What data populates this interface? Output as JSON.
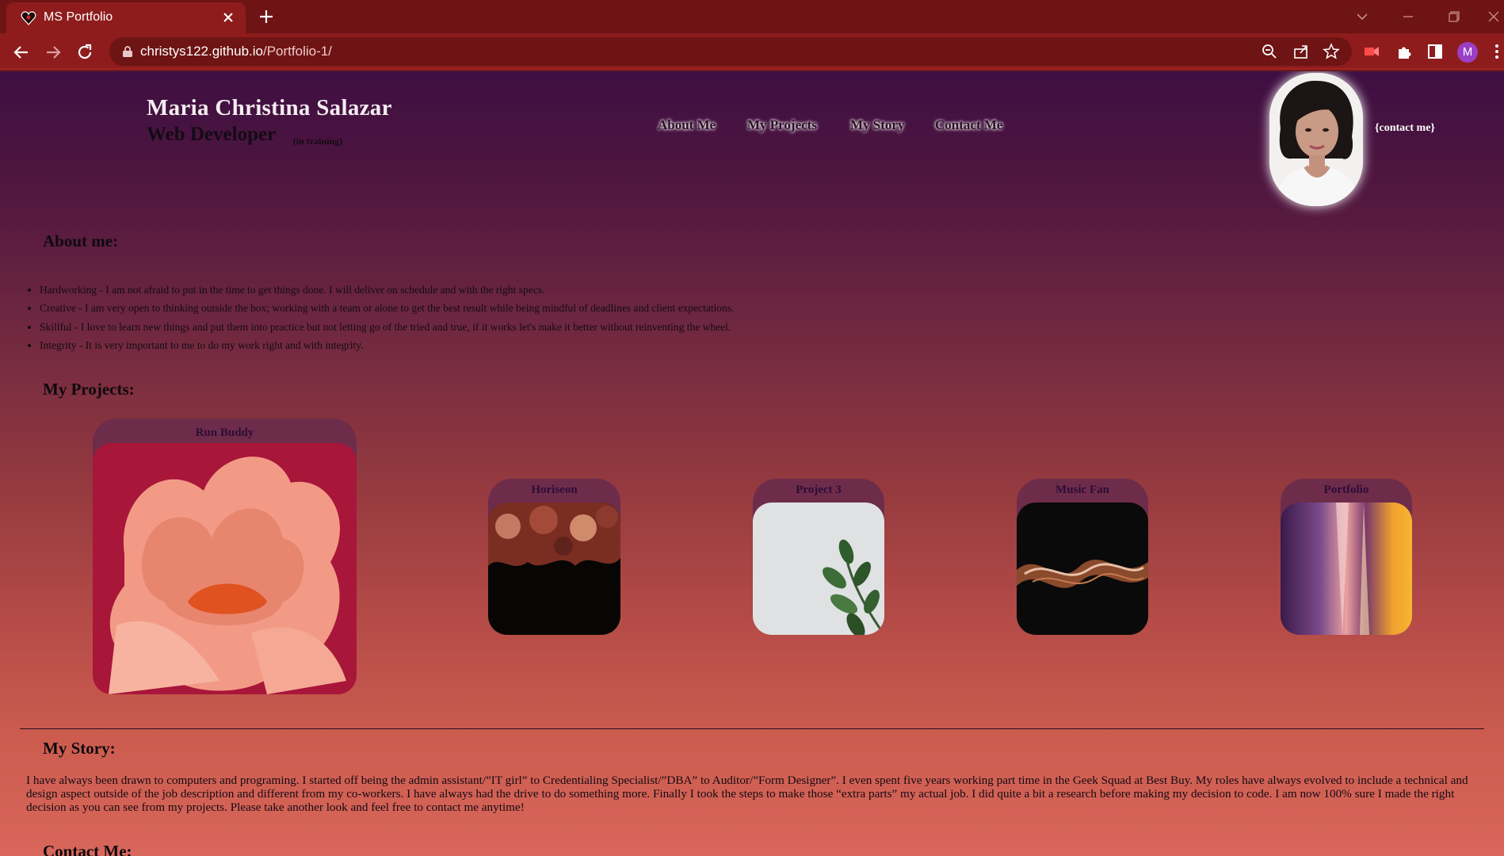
{
  "browser": {
    "tab_title": "MS Portfolio",
    "url_host": "christys122.github.io",
    "url_path": "/Portfolio-1/",
    "profile_initial": "M",
    "theme_color": "#8e1c1c"
  },
  "header": {
    "name": "Maria Christina Salazar",
    "role": "Web Developer",
    "role_note": "{in training}",
    "contact_link": "{contact me}"
  },
  "nav": {
    "about": "About Me",
    "projects": "My Projects",
    "story": "My Story",
    "contact": "Contact Me"
  },
  "about": {
    "heading": "About me:",
    "items": [
      "Hardworking - I am not afraid to put in the time to get things done. I will deliver on schedule and with the right specs.",
      "Creative - I am very open to thinking outside the box; working with a team or alone to get the best result while being mindful of deadlines and client expectations.",
      "Skillful - I love to learn new things and put them into practice but not letting go of the tried and true, if it works let's make it better without reinventing the wheel.",
      "Integrity - It is very important to me to do my work right and with integrity."
    ]
  },
  "projects": {
    "heading": "My Projects:",
    "items": [
      {
        "label": "Run Buddy"
      },
      {
        "label": "Horiseon"
      },
      {
        "label": "Project 3"
      },
      {
        "label": "Music Fan"
      },
      {
        "label": "Portfolio"
      }
    ]
  },
  "story": {
    "heading": "My Story:",
    "text": "I have always been drawn to computers and programing. I started off being the admin assistant/”IT girl” to Credentialing Specialist/”DBA” to Auditor/”Form Designer”. I even spent five years working part time in the Geek Squad at Best Buy. My roles have always evolved to include a technical and design aspect outside of the job description and different from my co-workers. I have always had the drive to do something more. Finally I took the steps to make those “extra parts” my actual job. I did quite a bit a research before making my decision to code. I am now 100% sure I made the right decision as you can see from my projects. Please take another look and feel free to contact me anytime!"
  },
  "contact": {
    "heading": "Contact Me:"
  }
}
